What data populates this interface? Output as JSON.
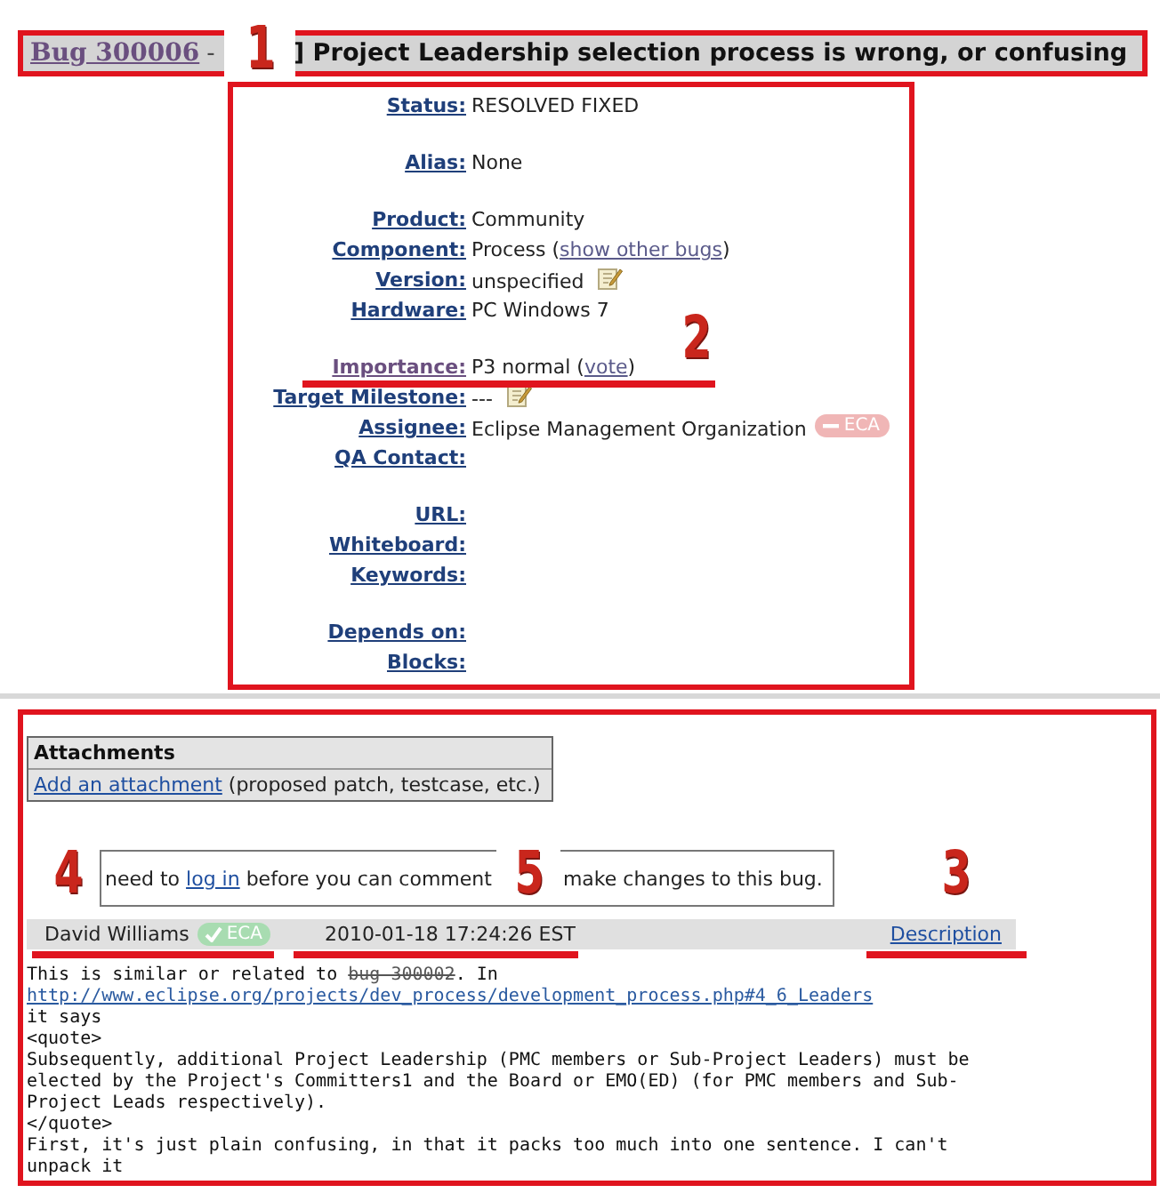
{
  "title_bar": {
    "bug_link": "Bug 300006",
    "separator": "-",
    "summary": "] Project Leadership selection process is wrong, or confusing"
  },
  "field_groups": [
    [
      {
        "label": "Status:",
        "visited": false,
        "edit_icon": false,
        "value": [
          {
            "kind": "text",
            "text": "RESOLVED FIXED"
          }
        ]
      }
    ],
    [
      {
        "label": "Alias:",
        "visited": false,
        "edit_icon": false,
        "value": [
          {
            "kind": "text",
            "text": "None"
          }
        ]
      }
    ],
    [
      {
        "label": "Product:",
        "visited": false,
        "edit_icon": false,
        "value": [
          {
            "kind": "text",
            "text": "Community"
          }
        ]
      },
      {
        "label": "Component:",
        "visited": false,
        "edit_icon": false,
        "value": [
          {
            "kind": "text",
            "text": "Process ("
          },
          {
            "kind": "link",
            "text": "show other bugs"
          },
          {
            "kind": "text",
            "text": ")"
          }
        ]
      },
      {
        "label": "Version:",
        "visited": false,
        "edit_icon": true,
        "value": [
          {
            "kind": "text",
            "text": "unspecified"
          }
        ]
      },
      {
        "label": "Hardware:",
        "visited": false,
        "edit_icon": false,
        "value": [
          {
            "kind": "text",
            "text": "PC Windows 7"
          }
        ]
      }
    ],
    [
      {
        "label": "Importance:",
        "visited": true,
        "edit_icon": false,
        "value": [
          {
            "kind": "text",
            "text": "P3 normal ("
          },
          {
            "kind": "link",
            "text": "vote"
          },
          {
            "kind": "text",
            "text": ")"
          }
        ]
      },
      {
        "label": "Target Milestone:",
        "visited": false,
        "edit_icon": true,
        "value": [
          {
            "kind": "text",
            "text": "---"
          }
        ]
      },
      {
        "label": "Assignee:",
        "visited": false,
        "edit_icon": false,
        "value": [
          {
            "kind": "text",
            "text": "Eclipse Management Organization"
          }
        ],
        "badge": {
          "text": "ECA",
          "kind": "missing"
        }
      },
      {
        "label": "QA Contact:",
        "visited": false,
        "edit_icon": false
      }
    ],
    [
      {
        "label": "URL:",
        "visited": false,
        "edit_icon": false
      },
      {
        "label": "Whiteboard:",
        "visited": false,
        "edit_icon": false
      },
      {
        "label": "Keywords:",
        "visited": false,
        "edit_icon": false
      }
    ],
    [
      {
        "label": "Depends on:",
        "visited": false,
        "edit_icon": false
      },
      {
        "label": "Blocks:",
        "visited": false,
        "edit_icon": false
      }
    ]
  ],
  "attachments": {
    "heading": "Attachments",
    "link": "Add an attachment",
    "note": "(proposed patch, testcase, etc.)"
  },
  "login_notice": {
    "before": "need to ",
    "link": "log in",
    "after": " before you can comment",
    "rest": "make changes to this bug."
  },
  "comment": {
    "author": "David Williams",
    "author_badge": {
      "text": "ECA",
      "kind": "valid"
    },
    "time": "2010-01-18 17:24:26 EST",
    "link": "Description",
    "lines": [
      [
        {
          "kind": "text",
          "text": "This is similar or related to "
        },
        {
          "kind": "struck-link",
          "text": "bug 300002"
        },
        {
          "kind": "text",
          "text": ". In"
        }
      ],
      [
        {
          "kind": "link",
          "text": "http://www.eclipse.org/projects/dev_process/development_process.php#4_6_Leaders"
        }
      ],
      [
        {
          "kind": "text",
          "text": "it says"
        }
      ],
      [
        {
          "kind": "text",
          "text": "<quote>"
        }
      ],
      [
        {
          "kind": "text",
          "text": "Subsequently, additional Project Leadership (PMC members or Sub-Project Leaders) must be"
        }
      ],
      [
        {
          "kind": "text",
          "text": "elected by the Project's Committers1 and the Board or EMO(ED) (for PMC members and Sub-"
        }
      ],
      [
        {
          "kind": "text",
          "text": "Project Leads respectively)."
        }
      ],
      [
        {
          "kind": "text",
          "text": "</quote>"
        }
      ],
      [
        {
          "kind": "text",
          "text": "First, it's just plain confusing, in that it packs too much into one sentence. I can't"
        }
      ],
      [
        {
          "kind": "text",
          "text": "unpack it"
        }
      ]
    ]
  },
  "annotations": {
    "callouts": [
      "1",
      "2",
      "4",
      "5",
      "3"
    ]
  }
}
